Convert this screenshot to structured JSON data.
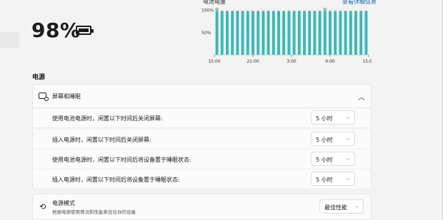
{
  "battery": {
    "percent": "98%",
    "charging": true,
    "level": 0.98
  },
  "usage_chart": {
    "title": "电池电量",
    "link": "查看详细信息"
  },
  "chart_data": {
    "type": "bar",
    "y_ticks": [
      "100%",
      "50%"
    ],
    "x_ticks": [
      "15:00",
      "21:00",
      "3:00",
      "9:00",
      "15:00"
    ],
    "ylim": [
      0,
      100
    ],
    "values": [
      98,
      98,
      98,
      98,
      98,
      98,
      98,
      98,
      98,
      98,
      98,
      98,
      98,
      98,
      98,
      98,
      98,
      98,
      98,
      98,
      98,
      98,
      98,
      98,
      98,
      98,
      98,
      98,
      98,
      98
    ],
    "plug_markers": [
      0,
      21
    ],
    "color": "#3bb8b8"
  },
  "section": {
    "title": "电源"
  },
  "screen_sleep": {
    "title": "屏幕和睡眠",
    "rows": [
      {
        "label": "使用电池电源时，闲置以下时间后关闭屏幕:",
        "value": "5 小时"
      },
      {
        "label": "插入电源时，闲置以下时间后关闭屏幕:",
        "value": "5 小时"
      },
      {
        "label": "使用电池电源时，闲置以下时间后将设备置于睡眠状态:",
        "value": "5 小时"
      },
      {
        "label": "插入电源时，闲置以下时间后将设备置于睡眠状态:",
        "value": "5 小时"
      }
    ]
  },
  "power_mode": {
    "title": "电源模式",
    "subtitle": "根据电源使用情况和性能来优化你的设备",
    "value": "最佳性能"
  },
  "icons": {
    "battery": "battery-charging-icon",
    "screen": "screen-sleep-icon",
    "chevron": "chevron-up-icon",
    "dropdown": "chevron-down-icon",
    "power_mode": "power-mode-icon"
  }
}
